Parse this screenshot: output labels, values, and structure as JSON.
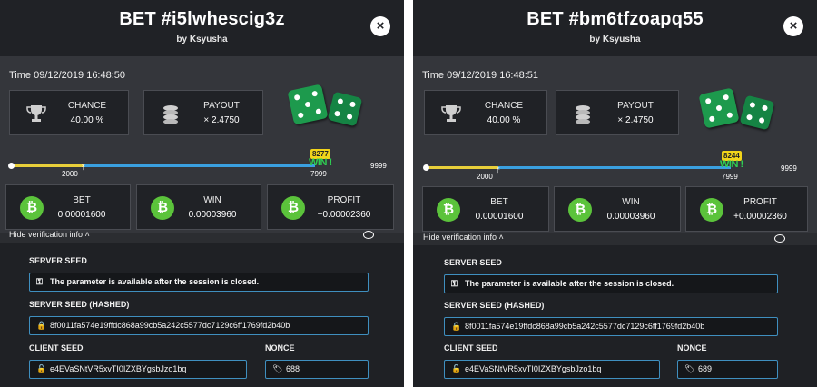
{
  "panels": [
    {
      "title": "BET #i5lwhescig3z",
      "byline": "by Ksyusha",
      "time": "Time 09/12/2019 16:48:50",
      "chance_label": "CHANCE",
      "chance_value": "40.00 %",
      "payout_label": "PAYOUT",
      "payout_value": "× 2.4750",
      "slider_min": "0",
      "slider_low": "2000",
      "slider_high": "7999",
      "slider_max": "9999",
      "rolled": "8277",
      "win_mark": "WIN !",
      "bet_label": "BET",
      "bet_value": "0.00001600",
      "win_label": "WIN",
      "win_value": "0.00003960",
      "profit_label": "PROFIT",
      "profit_value": "+0.00002360",
      "verify_label": "Hide verification info ˄",
      "server_seed_label": "SERVER SEED",
      "server_seed_value": "The parameter is available after the session is closed.",
      "hashed_label": "SERVER SEED (HASHED)",
      "hashed_value": "8f0011fa574e19ffdc868a99cb5a242c5577dc7129c6ff1769fd2b40b",
      "client_seed_label": "CLIENT SEED",
      "client_seed_value": "e4EVaSNtVR5xvTI0IZXBYgsbJzo1bq",
      "nonce_label": "NONCE",
      "nonce_value": "688"
    },
    {
      "title": "BET #bm6tfzoapq55",
      "byline": "by Ksyusha",
      "time": "Time 09/12/2019 16:48:51",
      "chance_label": "CHANCE",
      "chance_value": "40.00 %",
      "payout_label": "PAYOUT",
      "payout_value": "× 2.4750",
      "slider_min": "0",
      "slider_low": "2000",
      "slider_high": "7999",
      "slider_max": "9999",
      "rolled": "8244",
      "win_mark": "WIN !",
      "bet_label": "BET",
      "bet_value": "0.00001600",
      "win_label": "WIN",
      "win_value": "0.00003960",
      "profit_label": "PROFIT",
      "profit_value": "+0.00002360",
      "verify_label": "Hide verification info ˄",
      "server_seed_label": "SERVER SEED",
      "server_seed_value": "The parameter is available after the session is closed.",
      "hashed_label": "SERVER SEED (HASHED)",
      "hashed_value": "8f0011fa574e19ffdc868a99cb5a242c5577dc7129c6ff1769fd2b40b",
      "client_seed_label": "CLIENT SEED",
      "client_seed_value": "e4EVaSNtVR5xvTI0IZXBYgsbJzo1bq",
      "nonce_label": "NONCE",
      "nonce_value": "689"
    }
  ],
  "icons": {
    "close": "×",
    "bitcoin": "₿",
    "key": "⚿",
    "lock": "🔒",
    "unlock": "🔓",
    "tag": "🏷"
  },
  "colors": {
    "win": "#2ecf52",
    "bitcoin": "#5bc33b",
    "dice": "#1d9a4d",
    "slider_low": "#e8cf3a",
    "slider_high": "#3aa0e0",
    "field_border": "#3f8fbf"
  }
}
